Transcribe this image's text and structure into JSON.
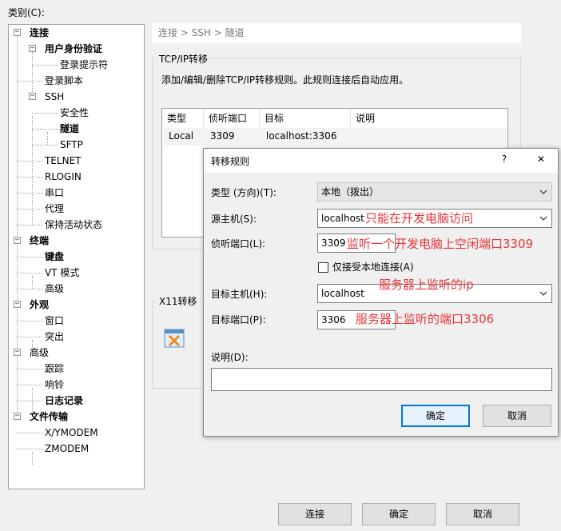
{
  "category_label": "类别(C):",
  "tree": [
    {
      "label": "连接",
      "bold": true,
      "expander": "−"
    },
    {
      "label": "用户身份验证",
      "bold": true,
      "expander": "−"
    },
    {
      "label": "登录提示符",
      "bold": false
    },
    {
      "label": "登录脚本",
      "bold": false
    },
    {
      "label": "SSH",
      "bold": false,
      "expander": "−"
    },
    {
      "label": "安全性",
      "bold": false
    },
    {
      "label": "隧道",
      "bold": true
    },
    {
      "label": "SFTP",
      "bold": false
    },
    {
      "label": "TELNET",
      "bold": false
    },
    {
      "label": "RLOGIN",
      "bold": false
    },
    {
      "label": "串口",
      "bold": false
    },
    {
      "label": "代理",
      "bold": false
    },
    {
      "label": "保持活动状态",
      "bold": false
    },
    {
      "label": "终端",
      "bold": true,
      "expander": "−"
    },
    {
      "label": "键盘",
      "bold": true
    },
    {
      "label": "VT 模式",
      "bold": false
    },
    {
      "label": "高级",
      "bold": false
    },
    {
      "label": "外观",
      "bold": true,
      "expander": "−"
    },
    {
      "label": "窗口",
      "bold": false
    },
    {
      "label": "突出",
      "bold": false
    },
    {
      "label": "高级",
      "bold": false,
      "expander": "−"
    },
    {
      "label": "跟踪",
      "bold": false
    },
    {
      "label": "响铃",
      "bold": false
    },
    {
      "label": "日志记录",
      "bold": true
    },
    {
      "label": "文件传输",
      "bold": true,
      "expander": "−"
    },
    {
      "label": "X/YMODEM",
      "bold": false
    },
    {
      "label": "ZMODEM",
      "bold": false
    }
  ],
  "breadcrumb": "连接 > SSH > 隧道",
  "tcp_group": {
    "title": "TCP/IP转移",
    "description": "添加/编辑/删除TCP/IP转移规则。此规则连接后自动应用。",
    "columns": [
      "类型",
      "侦听端口",
      "目标",
      "说明"
    ],
    "rows": [
      {
        "type": "Local",
        "listen_port": "3309",
        "target": "localhost:3306",
        "note": ""
      }
    ]
  },
  "x11_group": {
    "title": "X11转移"
  },
  "bottom_buttons": {
    "connect": "连接",
    "ok": "确定",
    "cancel": "取消"
  },
  "dialog": {
    "title": "转移规则",
    "help_glyph": "?",
    "close_glyph": "✕",
    "type_label": "类型 (方向)(T):",
    "type_value": "本地（拨出）",
    "source_host_label": "源主机(S):",
    "source_host_value": "localhost",
    "listen_port_label": "侦听端口(L):",
    "listen_port_value": "3309",
    "local_only_label": "仅接受本地连接(A)",
    "local_only_checked": false,
    "target_host_label": "目标主机(H):",
    "target_host_value": "localhost",
    "target_port_label": "目标端口(P):",
    "target_port_value": "3306",
    "description_label": "说明(D):",
    "description_value": "",
    "ok_label": "确定",
    "cancel_label": "取消"
  },
  "annotations": {
    "source_host_note": "只能在开发电脑访问",
    "listen_port_note": "监听一个开发电脑上空闲端口3309",
    "target_host_note": "服务器上监听的ip",
    "target_port_note": "服务器上监听的端口3306"
  },
  "colors": {
    "annotation": "#e8353a",
    "focus_border": "#0078d7"
  }
}
